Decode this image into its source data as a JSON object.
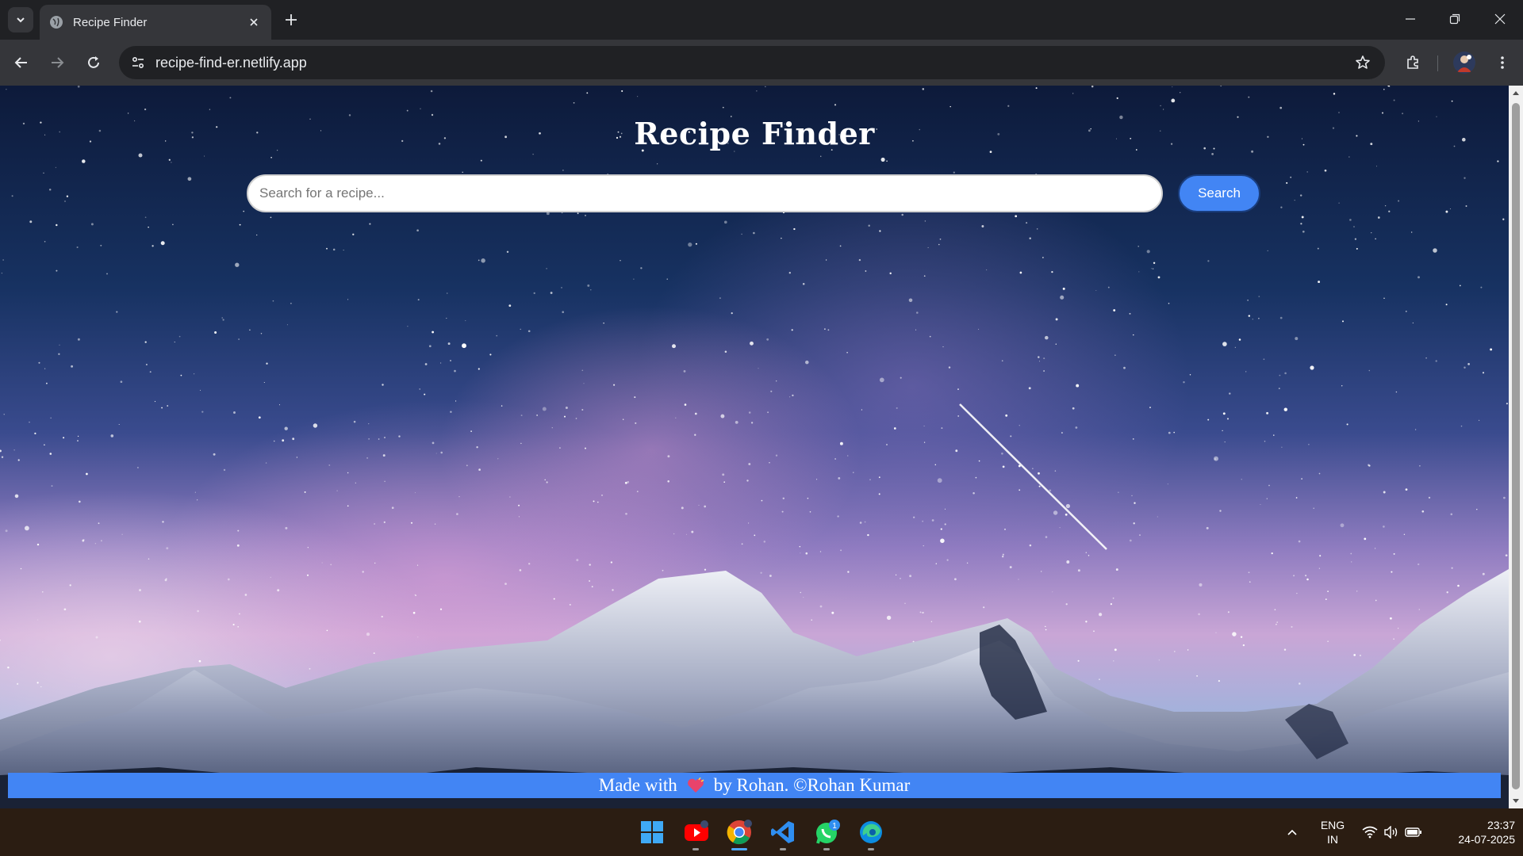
{
  "browser": {
    "tab": {
      "title": "Recipe Finder",
      "favicon": "globe-icon"
    },
    "url": "recipe-find-er.netlify.app",
    "icons": [
      "tab-search-icon",
      "close-icon",
      "new-tab-icon",
      "minimize-icon",
      "restore-icon",
      "window-close-icon",
      "back-icon",
      "forward-icon",
      "reload-icon",
      "site-info-icon",
      "bookmark-star-icon",
      "extensions-icon",
      "profile-avatar",
      "menu-icon"
    ]
  },
  "page": {
    "title": "Recipe Finder",
    "search": {
      "placeholder": "Search for a recipe...",
      "value": ""
    },
    "search_button": "Search",
    "footer": {
      "prefix": "Made with",
      "heart": "heart-icon",
      "suffix": "by Rohan. ©Rohan Kumar"
    },
    "colors": {
      "accent": "#4285f4",
      "title": "#ffffff"
    }
  },
  "taskbar": {
    "apps": [
      "windows-start-icon",
      "youtube-icon",
      "chrome-icon",
      "vscode-icon",
      "whatsapp-icon",
      "edge-icon"
    ],
    "whatsapp_badge": "1",
    "language": {
      "line1": "ENG",
      "line2": "IN"
    },
    "time": "23:37",
    "date": "24-07-2025"
  }
}
